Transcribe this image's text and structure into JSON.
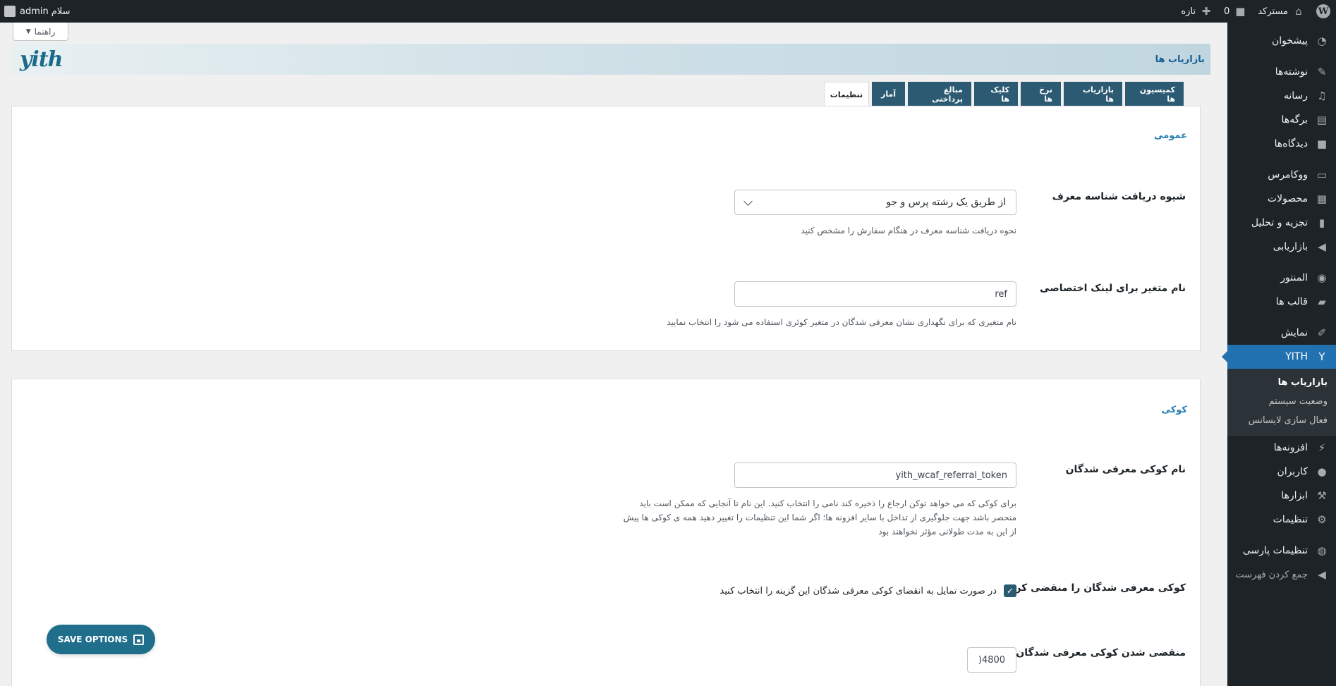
{
  "admin_bar": {
    "site_name": "مسترکد",
    "comments_count": "0",
    "new_label": "تازه",
    "greeting": "سلام admin"
  },
  "sidebar": {
    "items": [
      {
        "label": "پیشخوان",
        "icon": "dashboard-icon"
      },
      {
        "label": "نوشته‌ها",
        "icon": "pin-icon"
      },
      {
        "label": "رسانه",
        "icon": "media-icon"
      },
      {
        "label": "برگه‌ها",
        "icon": "pages-icon"
      },
      {
        "label": "دیدگاه‌ها",
        "icon": "comments-icon"
      },
      {
        "label": "ووکامرس",
        "icon": "woocommerce-icon"
      },
      {
        "label": "محصولات",
        "icon": "products-icon"
      },
      {
        "label": "تجزیه و تحلیل",
        "icon": "analytics-icon"
      },
      {
        "label": "بازاریابی",
        "icon": "megaphone-icon"
      },
      {
        "label": "المنتور",
        "icon": "elementor-icon"
      },
      {
        "label": "قالب ها",
        "icon": "folder-icon"
      },
      {
        "label": "نمایش",
        "icon": "brush-icon"
      },
      {
        "label": "YITH",
        "icon": "yith-icon"
      },
      {
        "label": "افزونه‌ها",
        "icon": "plugins-icon"
      },
      {
        "label": "کاربران",
        "icon": "users-icon"
      },
      {
        "label": "ابزارها",
        "icon": "tools-icon"
      },
      {
        "label": "تنظیمات",
        "icon": "settings-icon"
      },
      {
        "label": "تنظیمات پارسی",
        "icon": "globe-icon"
      },
      {
        "label": "جمع کردن فهرست",
        "icon": "collapse-icon"
      }
    ],
    "submenu": [
      "بازاریاب ها",
      "وضعیت سیستم",
      "فعال سازی لایسانس"
    ]
  },
  "help_tab": "راهنما",
  "banner": {
    "title": "بازاریاب ها",
    "logo_text": "yith"
  },
  "tabs": [
    "کمیسیون ها",
    "بازاریاب ها",
    "نرخ ها",
    "کلیک ها",
    "مبالغ پرداختی",
    "آمار",
    "تنظیمات"
  ],
  "active_tab": "تنظیمات",
  "general": {
    "section_title": "عمومی",
    "referral_method": {
      "label": "شیوه دریافت شناسه معرف",
      "value": "از طریق یک رشته پرس و جو",
      "description": "نحوه دریافت شناسه معرف در هنگام سفارش را مشخص کنید"
    },
    "ref_var": {
      "label": "نام متغیر برای لینک اختصاصی",
      "value": "ref",
      "description": "نام متغیری که برای نگهداری نشان معرفی شدگان در متغیر کوئری استفاده می شود را انتخاب نمایید"
    }
  },
  "cookie": {
    "section_title": "کوکی",
    "cookie_name": {
      "label": "نام کوکی معرفی شدگان",
      "value": "yith_wcaf_referral_token",
      "description": "برای کوکی که می خواهد توکن ارجاع را ذخیره کند نامی را انتخاب کنید. این نام تا آنجایی که ممکن است باید منحصر باشد جهت جلوگیری از تداخل با سایر افزونه ها؛ اگر شما این تنظیمات را تغییر دهید همه ی کوکی ها پیش از این به مدت طولانی مؤثر نخواهند بود"
    },
    "expire_cookie": {
      "label": "کوکی معرفی شدگان را منقضی کن",
      "checkbox_text": "در صورت تمایل به انقضای کوکی معرفی شدگان این گزینه را انتخاب کنید",
      "checked": true
    },
    "expiry": {
      "label": "منقضی شدن کوکی معرفی شدگان.",
      "value": "‪)4800"
    }
  },
  "save_button": "SAVE OPTIONS",
  "colors": {
    "sidebar_bg": "#1d2327",
    "active_menu": "#2271b1",
    "tab_bg": "#2b5a72",
    "save_bg": "#1f6f8c",
    "section_title": "#2b80b6"
  }
}
